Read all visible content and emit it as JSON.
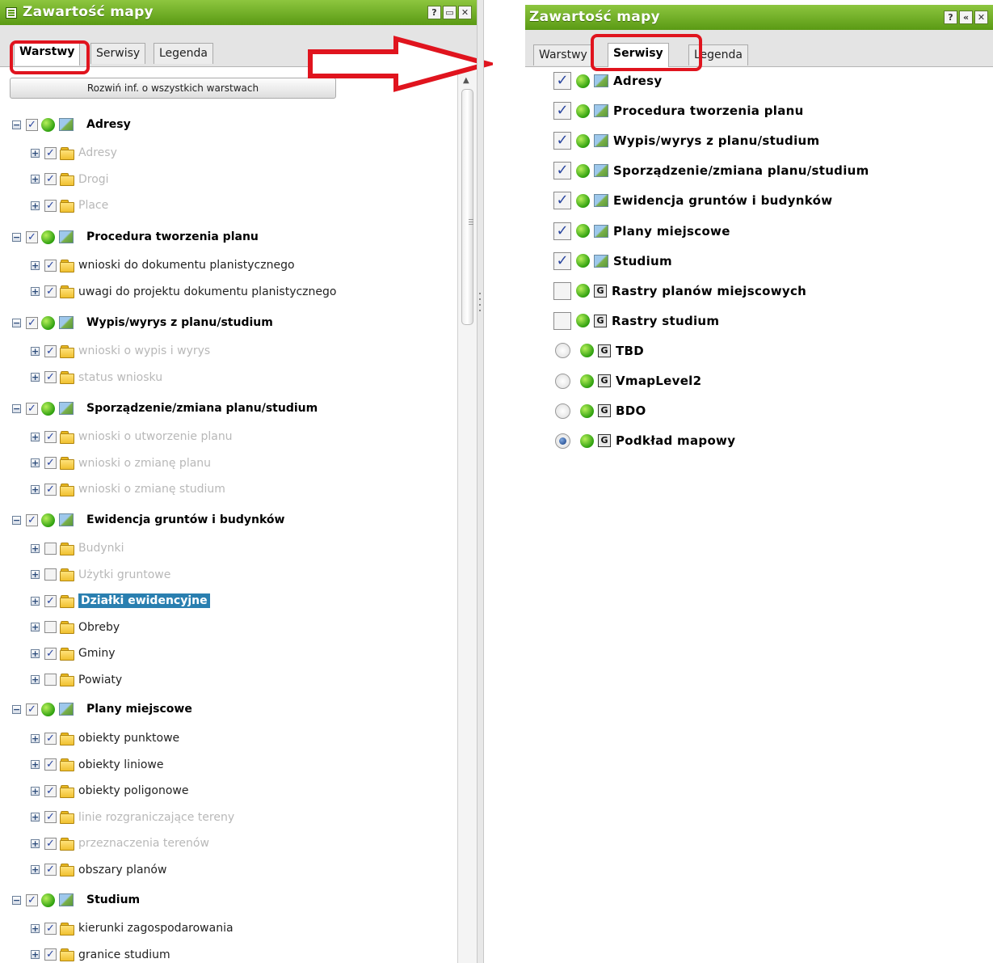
{
  "left_panel": {
    "title": "Zawartość mapy",
    "title_buttons": [
      "?",
      "▭",
      "✕"
    ],
    "tabs": [
      "Warstwy",
      "Serwisy",
      "Legenda"
    ],
    "expand_all_label": "Rozwiń inf. o wszystkich warstwach",
    "tree": [
      {
        "label": "Adresy",
        "children": [
          {
            "label": "Adresy",
            "checked": true,
            "dim": true
          },
          {
            "label": "Drogi",
            "checked": true,
            "dim": true
          },
          {
            "label": "Place",
            "checked": true,
            "dim": true
          }
        ]
      },
      {
        "label": "Procedura tworzenia planu",
        "children": [
          {
            "label": "wnioski do dokumentu planistycznego",
            "checked": true,
            "dim": false
          },
          {
            "label": "uwagi do projektu dokumentu planistycznego",
            "checked": true,
            "dim": false
          }
        ]
      },
      {
        "label": "Wypis/wyrys z planu/studium",
        "children": [
          {
            "label": "wnioski o wypis i wyrys",
            "checked": true,
            "dim": true
          },
          {
            "label": "status wniosku",
            "checked": true,
            "dim": true
          }
        ]
      },
      {
        "label": "Sporządzenie/zmiana planu/studium",
        "children": [
          {
            "label": "wnioski o utworzenie planu",
            "checked": true,
            "dim": true
          },
          {
            "label": "wnioski o zmianę planu",
            "checked": true,
            "dim": true
          },
          {
            "label": "wnioski o zmianę studium",
            "checked": true,
            "dim": true
          }
        ]
      },
      {
        "label": "Ewidencja gruntów i budynków",
        "children": [
          {
            "label": "Budynki",
            "checked": false,
            "dim": true
          },
          {
            "label": "Użytki gruntowe",
            "checked": false,
            "dim": true
          },
          {
            "label": "Działki ewidencyjne",
            "checked": true,
            "dim": false,
            "selected": true
          },
          {
            "label": "Obreby",
            "checked": false,
            "dim": false
          },
          {
            "label": "Gminy",
            "checked": true,
            "dim": false
          },
          {
            "label": "Powiaty",
            "checked": false,
            "dim": false
          }
        ]
      },
      {
        "label": "Plany miejscowe",
        "children": [
          {
            "label": "obiekty punktowe",
            "checked": true,
            "dim": false
          },
          {
            "label": "obiekty liniowe",
            "checked": true,
            "dim": false
          },
          {
            "label": "obiekty poligonowe",
            "checked": true,
            "dim": false
          },
          {
            "label": "linie rozgraniczające tereny",
            "checked": true,
            "dim": true
          },
          {
            "label": "przeznaczenia terenów",
            "checked": true,
            "dim": true
          },
          {
            "label": "obszary planów",
            "checked": true,
            "dim": false
          }
        ]
      },
      {
        "label": "Studium",
        "children": [
          {
            "label": "kierunki zagospodarowania",
            "checked": true,
            "dim": false
          },
          {
            "label": "granice studium",
            "checked": true,
            "dim": false
          }
        ]
      }
    ]
  },
  "right_panel": {
    "title": "Zawartość mapy",
    "title_buttons": [
      "?",
      "«",
      "✕"
    ],
    "tabs": [
      "Warstwy",
      "Serwisy",
      "Legenda"
    ],
    "services": [
      {
        "label": "Adresy",
        "control": "checkbox",
        "checked": true,
        "icon": "map"
      },
      {
        "label": "Procedura tworzenia planu",
        "control": "checkbox",
        "checked": true,
        "icon": "map"
      },
      {
        "label": "Wypis/wyrys z planu/studium",
        "control": "checkbox",
        "checked": true,
        "icon": "map"
      },
      {
        "label": "Sporządzenie/zmiana planu/studium",
        "control": "checkbox",
        "checked": true,
        "icon": "map"
      },
      {
        "label": "Ewidencja gruntów i budynków",
        "control": "checkbox",
        "checked": true,
        "icon": "map"
      },
      {
        "label": "Plany miejscowe",
        "control": "checkbox",
        "checked": true,
        "icon": "map"
      },
      {
        "label": "Studium",
        "control": "checkbox",
        "checked": true,
        "icon": "map"
      },
      {
        "label": "Rastry planów miejscowych",
        "control": "checkbox",
        "checked": false,
        "icon": "G"
      },
      {
        "label": "Rastry studium",
        "control": "checkbox",
        "checked": false,
        "icon": "G"
      },
      {
        "label": "TBD",
        "control": "radio",
        "checked": false,
        "icon": "G"
      },
      {
        "label": "VmapLevel2",
        "control": "radio",
        "checked": false,
        "icon": "G"
      },
      {
        "label": "BDO",
        "control": "radio",
        "checked": false,
        "icon": "G"
      },
      {
        "label": "Podkład mapowy",
        "control": "radio",
        "checked": true,
        "icon": "G"
      }
    ]
  },
  "colors": {
    "title_green": "#6aad1f",
    "highlight_red": "#e0141e",
    "selection_blue": "#2a7fb0"
  }
}
